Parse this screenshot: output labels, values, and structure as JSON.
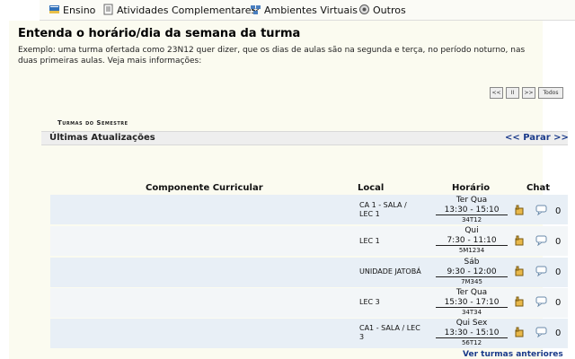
{
  "menu": [
    {
      "label": "Ensino",
      "icon": "book-icon"
    },
    {
      "label": "Atividades Complementares",
      "icon": "document-icon"
    },
    {
      "label": "Ambientes Virtuais",
      "icon": "network-icon"
    },
    {
      "label": "Outros",
      "icon": "tools-icon"
    }
  ],
  "info": {
    "title": "Entenda o horário/dia da semana da turma",
    "description": "Exemplo: uma turma ofertada como 23N12 quer dizer, que os dias de aulas são na segunda e terça, no período noturno, nas duas primeiras aulas. Veja mais informações:"
  },
  "pager": {
    "first": "<<",
    "pause": "II",
    "next": ">>",
    "all": "Todos"
  },
  "section_label": "Turmas do Semestre",
  "updates": {
    "title": "Últimas Atualizações",
    "link": "<< Parar >>"
  },
  "table": {
    "headers": {
      "componente": "Componente Curricular",
      "local": "Local",
      "horario": "Horário",
      "chat": "Chat"
    },
    "rows": [
      {
        "local": "CA 1 - SALA / LEC 1",
        "dias": "Ter Qua",
        "horas": "13:30 - 15:10",
        "codigo": "34T12",
        "chat": "0"
      },
      {
        "local": "LEC 1",
        "dias": "Qui",
        "horas": "7:30 - 11:10",
        "codigo": "5M1234",
        "chat": "0"
      },
      {
        "local": "UNIDADE JATOBÁ",
        "dias": "Sáb",
        "horas": "9:30 - 12:00",
        "codigo": "7M345",
        "chat": "0"
      },
      {
        "local": "LEC 3",
        "dias": "Ter Qua",
        "horas": "15:30 - 17:10",
        "codigo": "34T34",
        "chat": "0"
      },
      {
        "local": "CA1 - SALA / LEC 3",
        "dias": "Qui Sex",
        "horas": "13:30 - 15:10",
        "codigo": "56T12",
        "chat": "0"
      }
    ]
  },
  "more_link": "Ver turmas anteriores"
}
